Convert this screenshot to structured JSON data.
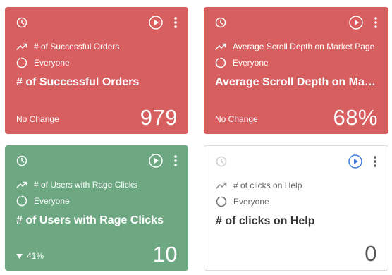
{
  "cards": [
    {
      "metric_label": "# of Successful Orders",
      "segment_label": "Everyone",
      "title": "# of Successful Orders",
      "change": "No Change",
      "value": "979",
      "theme": "red"
    },
    {
      "metric_label": "Average Scroll Depth on Market Page",
      "segment_label": "Everyone",
      "title": "Average Scroll Depth on Mark...",
      "change": "No Change",
      "value": "68%",
      "theme": "red"
    },
    {
      "metric_label": "# of Users with Rage Clicks",
      "segment_label": "Everyone",
      "title": "# of Users with Rage Clicks",
      "change": "41%",
      "change_direction": "down",
      "value": "10",
      "theme": "green"
    },
    {
      "metric_label": "# of clicks on Help",
      "segment_label": "Everyone",
      "title": "# of clicks on Help",
      "change": "",
      "value": "0",
      "theme": "white"
    }
  ],
  "colors": {
    "red": "#d85f5f",
    "green": "#6ea883",
    "white": "#ffffff",
    "accent_blue": "#3b7ddd"
  },
  "icons": [
    "clock-icon",
    "play-icon",
    "kebab-menu-icon",
    "trend-icon",
    "segment-icon",
    "down-triangle-icon"
  ]
}
